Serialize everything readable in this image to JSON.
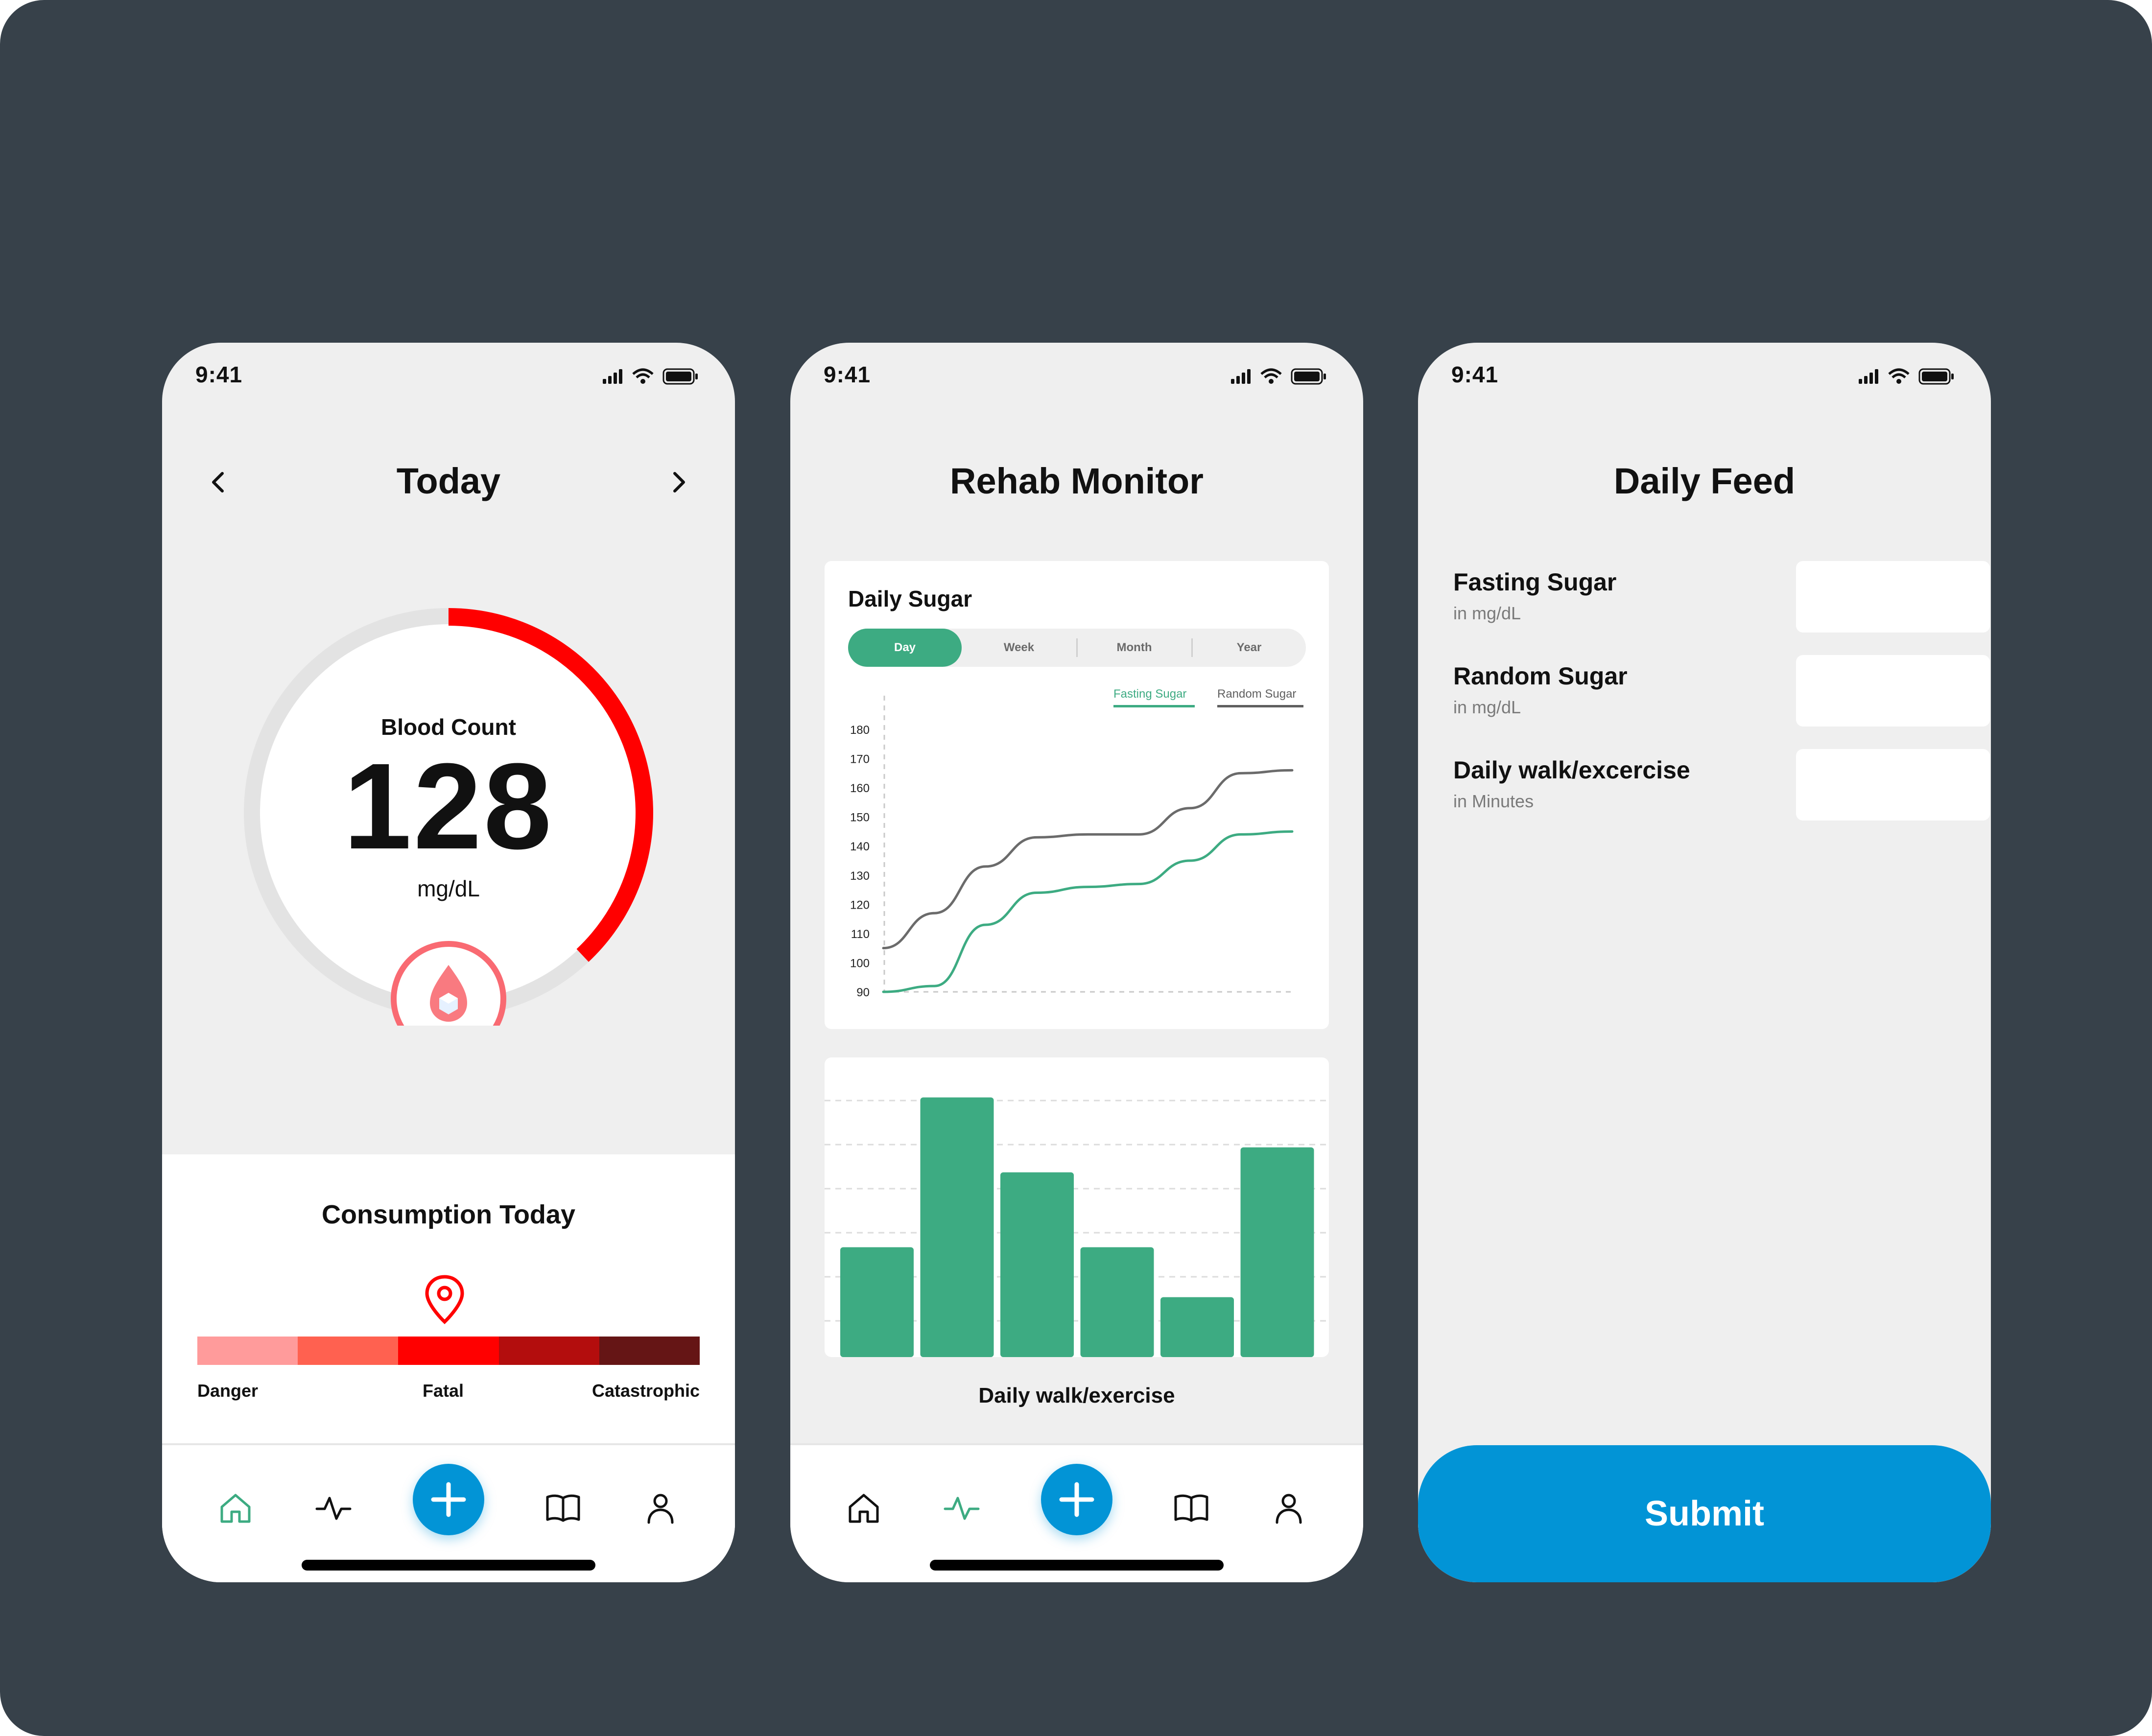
{
  "status": {
    "time": "9:41"
  },
  "today": {
    "title": "Today",
    "gauge": {
      "label": "Blood Count",
      "value": "128",
      "unit": "mg/dL",
      "fill_fraction": 0.38
    },
    "consumption": {
      "title": "Consumption Today",
      "scale_colors": [
        "#ff9b9b",
        "#ff6150",
        "#ff0000",
        "#b30d0d",
        "#651515"
      ],
      "labels": [
        "Danger",
        "Fatal",
        "Catastrophic"
      ],
      "marker_segment": 2
    }
  },
  "rehab": {
    "title": "Rehab Monitor",
    "card_title": "Daily Sugar",
    "tabs": [
      "Day",
      "Week",
      "Month",
      "Year"
    ],
    "active_tab": 0,
    "legend": [
      "Fasting Sugar",
      "Random Sugar"
    ],
    "bar_caption": "Daily walk/exercise"
  },
  "feed": {
    "title": "Daily Feed",
    "fields": [
      {
        "label": "Fasting Sugar",
        "sub": "in mg/dL",
        "value": ""
      },
      {
        "label": "Random Sugar",
        "sub": "in mg/dL",
        "value": ""
      },
      {
        "label": "Daily walk/excercise",
        "sub": "in Minutes",
        "value": ""
      }
    ],
    "submit": "Submit"
  },
  "colors": {
    "accent_green": "#3dab82",
    "accent_blue": "#0294d6",
    "alert_red": "#ff0000",
    "background": "#37414a"
  },
  "chart_data": [
    {
      "type": "line",
      "title": "Daily Sugar",
      "ylim": [
        90,
        180
      ],
      "yticks": [
        90,
        100,
        110,
        120,
        130,
        140,
        150,
        160,
        170,
        180
      ],
      "x": [
        0,
        1,
        2,
        3,
        4,
        5,
        6
      ],
      "series": [
        {
          "name": "Fasting Sugar",
          "color": "#3dab82",
          "values": [
            90,
            92,
            113,
            124,
            126,
            127,
            135,
            144,
            145
          ]
        },
        {
          "name": "Random Sugar",
          "color": "#6b6b6b",
          "values": [
            105,
            117,
            133,
            143,
            144,
            144,
            153,
            165,
            166
          ]
        }
      ],
      "grid": false
    },
    {
      "type": "bar",
      "title": "Daily walk/exercise",
      "values": [
        22,
        52,
        37,
        22,
        12,
        42
      ],
      "ylim": [
        0,
        60
      ],
      "grid": true,
      "color": "#3dab82"
    }
  ]
}
